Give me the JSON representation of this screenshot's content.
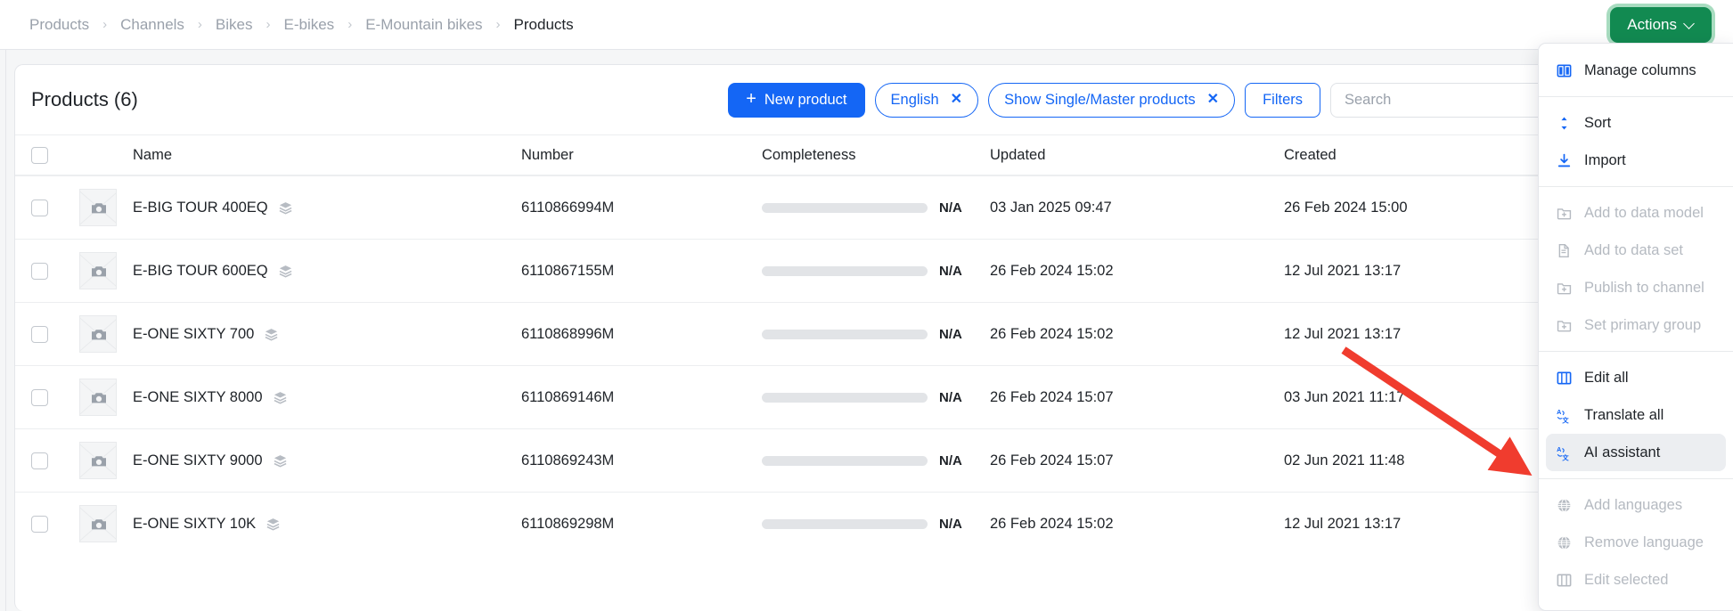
{
  "breadcrumb": {
    "items": [
      {
        "label": "Products",
        "current": false
      },
      {
        "label": "Channels",
        "current": false
      },
      {
        "label": "Bikes",
        "current": false
      },
      {
        "label": "E-bikes",
        "current": false
      },
      {
        "label": "E-Mountain bikes",
        "current": false
      },
      {
        "label": "Products",
        "current": true
      }
    ],
    "separator": "›"
  },
  "actions_button": {
    "label": "Actions",
    "color": "#128a51",
    "focus_ring": "#a8dcc0"
  },
  "card": {
    "title": "Products (6)"
  },
  "toolbar": {
    "new_product_label": "New product",
    "new_product_plus": "+",
    "language_pill_label": "English",
    "language_pill_close": "✕",
    "show_products_pill_label": "Show Single/Master products",
    "show_products_pill_close": "✕",
    "filters_label": "Filters",
    "search_placeholder": "Search",
    "search_value": "",
    "accent_color": "#1466f5"
  },
  "table": {
    "columns": [
      {
        "key": "name",
        "label": "Name"
      },
      {
        "key": "number",
        "label": "Number"
      },
      {
        "key": "completeness",
        "label": "Completeness"
      },
      {
        "key": "updated",
        "label": "Updated"
      },
      {
        "key": "created",
        "label": "Created"
      }
    ],
    "completeness_na": "N/A",
    "rows": [
      {
        "name": "E-BIG TOUR 400EQ",
        "number": "6110866994M",
        "completeness": "N/A",
        "updated": "03 Jan 2025 09:47",
        "created": "26 Feb 2024 15:00"
      },
      {
        "name": "E-BIG TOUR 600EQ",
        "number": "6110867155M",
        "completeness": "N/A",
        "updated": "26 Feb 2024 15:02",
        "created": "12 Jul 2021 13:17"
      },
      {
        "name": "E-ONE SIXTY 700",
        "number": "6110868996M",
        "completeness": "N/A",
        "updated": "26 Feb 2024 15:02",
        "created": "12 Jul 2021 13:17"
      },
      {
        "name": "E-ONE SIXTY 8000",
        "number": "6110869146M",
        "completeness": "N/A",
        "updated": "26 Feb 2024 15:07",
        "created": "03 Jun 2021 11:17"
      },
      {
        "name": "E-ONE SIXTY 9000",
        "number": "6110869243M",
        "completeness": "N/A",
        "updated": "26 Feb 2024 15:07",
        "created": "02 Jun 2021 11:48"
      },
      {
        "name": "E-ONE SIXTY 10K",
        "number": "6110869298M",
        "completeness": "N/A",
        "updated": "26 Feb 2024 15:02",
        "created": "12 Jul 2021 13:17"
      }
    ]
  },
  "actions_menu": {
    "groups": [
      {
        "items": [
          {
            "label": "Manage columns",
            "icon": "columns-icon",
            "state": "enabled"
          }
        ]
      },
      {
        "items": [
          {
            "label": "Sort",
            "icon": "sort-icon",
            "state": "enabled"
          },
          {
            "label": "Import",
            "icon": "import-icon",
            "state": "enabled"
          }
        ]
      },
      {
        "items": [
          {
            "label": "Add to data model",
            "icon": "folder-plus-icon",
            "state": "disabled"
          },
          {
            "label": "Add to data set",
            "icon": "document-icon",
            "state": "disabled"
          },
          {
            "label": "Publish to channel",
            "icon": "folder-plus-icon",
            "state": "disabled"
          },
          {
            "label": "Set primary group",
            "icon": "folder-plus-icon",
            "state": "disabled"
          }
        ]
      },
      {
        "items": [
          {
            "label": "Edit all",
            "icon": "table-icon",
            "state": "enabled"
          },
          {
            "label": "Translate all",
            "icon": "translate-icon",
            "state": "enabled"
          },
          {
            "label": "AI assistant",
            "icon": "translate-icon",
            "state": "highlighted"
          }
        ]
      },
      {
        "items": [
          {
            "label": "Add languages",
            "icon": "globe-icon",
            "state": "disabled"
          },
          {
            "label": "Remove language",
            "icon": "globe-icon",
            "state": "disabled"
          },
          {
            "label": "Edit selected",
            "icon": "table-icon",
            "state": "disabled"
          }
        ]
      }
    ]
  },
  "annotation": {
    "arrow_color": "#f03c2e",
    "points_to": "AI assistant"
  }
}
